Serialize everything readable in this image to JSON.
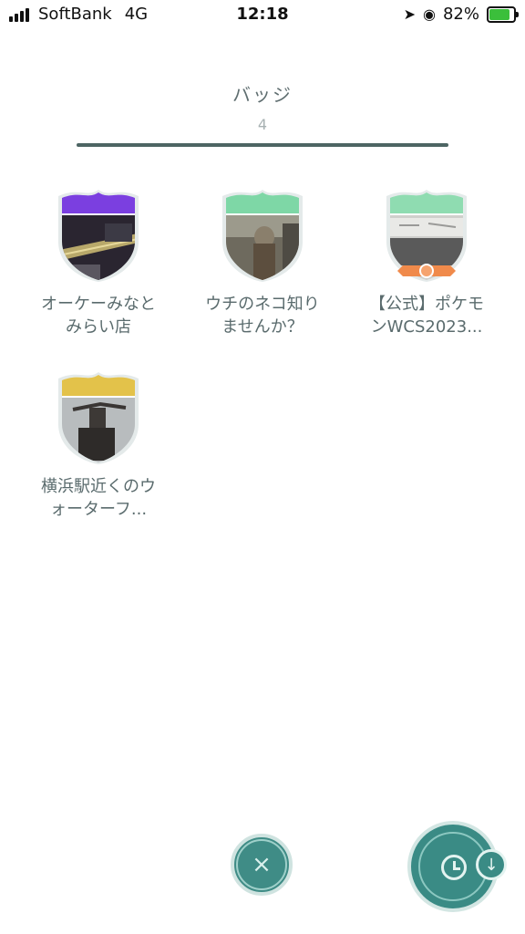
{
  "status_bar": {
    "carrier": "SoftBank",
    "network": "4G",
    "time": "12:18",
    "battery_percent": "82%",
    "battery_level": 0.82
  },
  "header": {
    "title": "バッジ",
    "count": "4"
  },
  "badges": [
    {
      "label_line1": "オーケーみなと",
      "label_line2": "みらい店",
      "tier_color": "#7b3fe0",
      "photo": "bridge-night"
    },
    {
      "label_line1": "ウチのネコ知り",
      "label_line2": "ませんか？",
      "tier_color": "#7ed7a6",
      "photo": "person-street"
    },
    {
      "label_line1": "【公式】ポケモ",
      "label_line2": "ンWCS2023...",
      "tier_color": "#8fdcb1",
      "photo": "whiteboard",
      "ribbon_color": "#f08a4b"
    },
    {
      "label_line1": "横浜駅近くのウ",
      "label_line2": "ォーターフ...",
      "tier_color": "#e3c24a",
      "photo": "statue"
    }
  ],
  "controls": {
    "close_icon": "×",
    "sort_direction_icon": "↓"
  },
  "colors": {
    "accent": "#3a8b85",
    "divider": "#4d6563"
  }
}
